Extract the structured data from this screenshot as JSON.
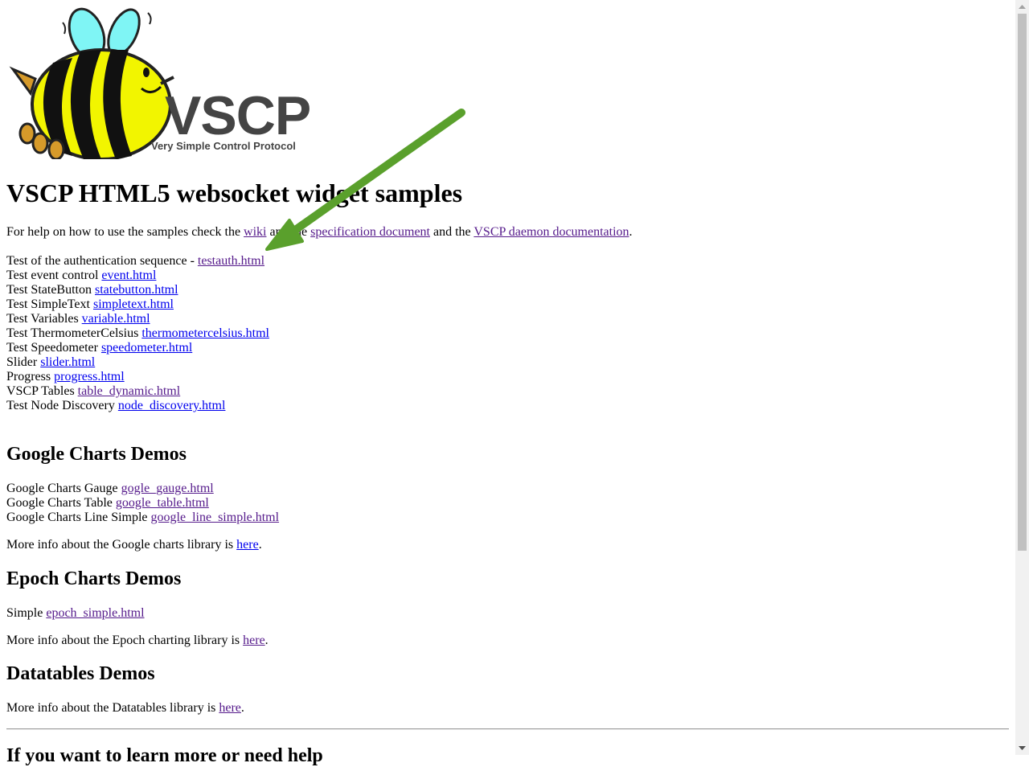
{
  "logo": {
    "wordmark": "VSCP",
    "tagline": "Very Simple Control Protocol"
  },
  "main": {
    "title": "VSCP HTML5 websocket widget samples",
    "intro": {
      "prefix": "For help on how to use the samples check the ",
      "link1": "wiki",
      "middle": " and the ",
      "link2": "specification document",
      "middle2": " and the ",
      "link3": "VSCP daemon documentation",
      "suffix": "."
    },
    "tests": [
      {
        "label": "Test of the authentication sequence - ",
        "link": "testauth.html"
      },
      {
        "label": "Test event control ",
        "link": "event.html"
      },
      {
        "label": "Test StateButton ",
        "link": "statebutton.html"
      },
      {
        "label": "Test SimpleText ",
        "link": "simpletext.html"
      },
      {
        "label": "Test Variables ",
        "link": "variable.html"
      },
      {
        "label": "Test ThermometerCelsius ",
        "link": "thermometercelsius.html"
      },
      {
        "label": "Test Speedometer ",
        "link": "speedometer.html"
      },
      {
        "label": "Slider ",
        "link": "slider.html"
      },
      {
        "label": "Progress ",
        "link": "progress.html"
      },
      {
        "label": "VSCP Tables ",
        "link": "table_dynamic.html"
      },
      {
        "label": "Test Node Discovery ",
        "link": "node_discovery.html"
      }
    ]
  },
  "google": {
    "heading": "Google Charts Demos",
    "items": [
      {
        "label": "Google Charts Gauge ",
        "link": "gogle_gauge.html"
      },
      {
        "label": "Google Charts Table ",
        "link": "google_table.html"
      },
      {
        "label": "Google Charts Line Simple ",
        "link": "google_line_simple.html"
      }
    ],
    "more_prefix": "More info about the Google charts library is ",
    "more_link": "here",
    "more_suffix": "."
  },
  "epoch": {
    "heading": "Epoch Charts Demos",
    "item_label": "Simple ",
    "item_link": "epoch_simple.html",
    "more_prefix": "More info about the Epoch charting library is ",
    "more_link": "here",
    "more_suffix": "."
  },
  "datatables": {
    "heading": "Datatables Demos",
    "more_prefix": "More info about the Datatables library is ",
    "more_link": "here",
    "more_suffix": "."
  },
  "footer": {
    "heading_partial": "If you want to learn more or need help"
  },
  "colors": {
    "visited_link": "#551a8b",
    "unvisited_link": "#0000ee",
    "annotation_arrow": "#5aa02c"
  }
}
